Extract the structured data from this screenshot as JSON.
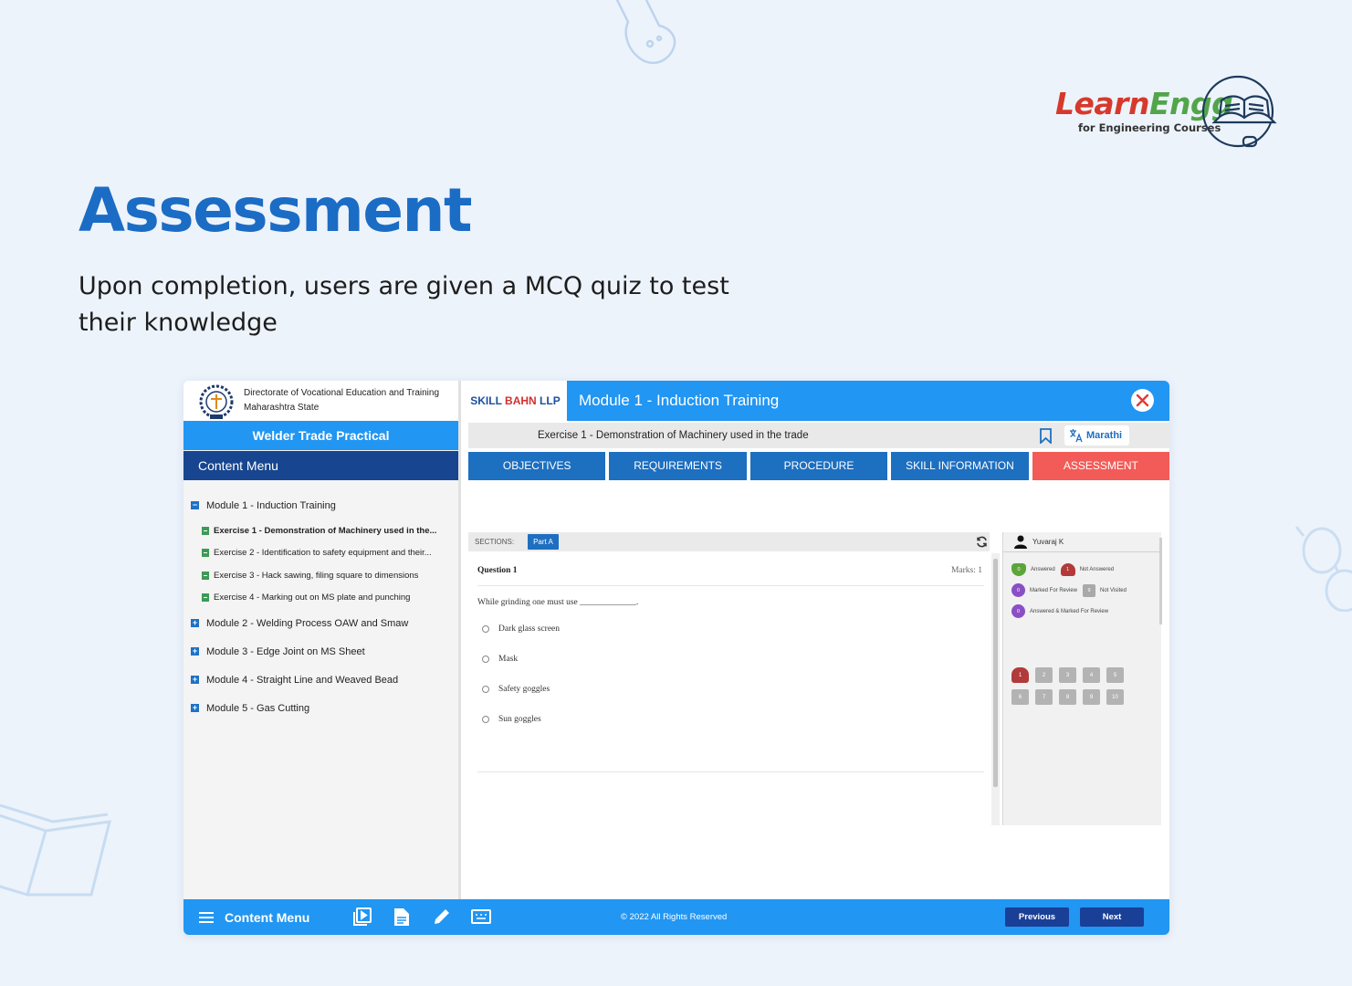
{
  "brand": {
    "learn": "Learn",
    "engg": "Engg",
    "tagline": "for Engineering Courses"
  },
  "hero": {
    "title": "Assessment",
    "subtitle": "Upon completion, users are given a MCQ quiz to test their knowledge"
  },
  "org": {
    "line1": "Directorate of Vocational Education and Training",
    "line2": "Maharashtra State"
  },
  "trade": "Welder Trade Practical",
  "content_menu": "Content Menu",
  "tree": [
    {
      "type": "module",
      "expanded": true,
      "label": "Module 1 - Induction Training"
    },
    {
      "type": "exercise",
      "active": true,
      "label": "Exercise 1 - Demonstration of  Machinery used in the..."
    },
    {
      "type": "exercise",
      "label": "Exercise 2 - Identification to safety equipment and their..."
    },
    {
      "type": "exercise",
      "label": "Exercise 3 - Hack sawing, filing square to dimensions"
    },
    {
      "type": "exercise",
      "label": "Exercise 4 - Marking out on MS plate and punching"
    },
    {
      "type": "module",
      "label": "Module 2 - Welding Process OAW and Smaw"
    },
    {
      "type": "module",
      "label": "Module 3 - Edge Joint on MS Sheet"
    },
    {
      "type": "module",
      "label": "Module 4 - Straight Line and Weaved Bead"
    },
    {
      "type": "module",
      "label": "Module 5 - Gas Cutting"
    }
  ],
  "header": {
    "company_a": "SKILL ",
    "company_b": "BAHN",
    "company_c": " LLP",
    "module_title": "Module 1 - Induction Training",
    "exercise_title": "Exercise 1 - Demonstration of Machinery used in the trade",
    "language": "Marathi"
  },
  "tabs": [
    {
      "label": "OBJECTIVES",
      "active": false
    },
    {
      "label": "REQUIREMENTS",
      "active": false
    },
    {
      "label": "PROCEDURE",
      "active": false
    },
    {
      "label": "SKILL INFORMATION",
      "active": false
    },
    {
      "label": "ASSESSMENT",
      "active": true
    }
  ],
  "quiz": {
    "sections_label": "SECTIONS:",
    "part": "Part A",
    "question_label": "Question 1",
    "marks": "Marks: 1",
    "question_text": "While grinding one must use _____________.",
    "options": [
      "Dark glass screen",
      "Mask",
      "Safety goggles",
      "Sun goggles"
    ]
  },
  "palette": {
    "user": "Yuvaraj K",
    "legend": {
      "answered": {
        "count": "0",
        "label": "Answered"
      },
      "not_answered": {
        "count": "1",
        "label": "Not Answered"
      },
      "marked": {
        "count": "0",
        "label": "Marked For Review"
      },
      "not_visited": {
        "count": "9",
        "label": "Not Visited"
      },
      "answered_marked": {
        "count": "0",
        "label": "Answered & Marked For Review"
      }
    },
    "questions": [
      "1",
      "2",
      "3",
      "4",
      "5",
      "6",
      "7",
      "8",
      "9",
      "10"
    ],
    "current": "1"
  },
  "footer": {
    "menu_label": "Content Menu",
    "copyright": "2022 All Rights Reserved",
    "previous": "Previous",
    "next": "Next"
  },
  "colors": {
    "primary": "#2196f3",
    "dark_blue": "#17458f",
    "tab_blue": "#1d6fc0",
    "assessment_red": "#f25b57",
    "title_blue": "#1b6cc4"
  },
  "icons": [
    "flask-icon",
    "book-icon",
    "glasses-icon",
    "close-icon",
    "bookmark-icon",
    "translate-icon",
    "refresh-icon",
    "user-icon",
    "hamburger-icon",
    "video-icon",
    "document-icon",
    "pencil-icon",
    "keyboard-icon",
    "copyright-icon"
  ]
}
